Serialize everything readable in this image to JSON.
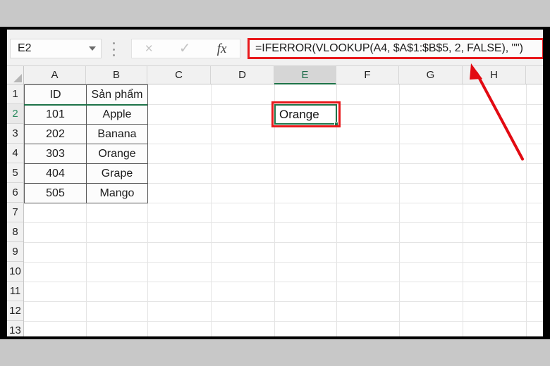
{
  "app": "excel-spreadsheet",
  "formula_bar": {
    "name_box_value": "E2",
    "name_box_caret": "chevron-down-icon",
    "cancel_icon": "×",
    "confirm_icon": "✓",
    "fx_icon": "fx",
    "formula": "=IFERROR(VLOOKUP(A4, $A$1:$B$5, 2, FALSE), \"\")",
    "highlight_color": "#e8181b"
  },
  "grid": {
    "columns": [
      "A",
      "B",
      "C",
      "D",
      "E",
      "F",
      "G",
      "H"
    ],
    "selected_column": "E",
    "rows": [
      "1",
      "2",
      "3",
      "4",
      "5",
      "6",
      "7",
      "8",
      "9",
      "10",
      "11",
      "12",
      "13"
    ],
    "selected_row": "2",
    "selection_color": "#1d7348"
  },
  "table": {
    "headers": [
      "ID",
      "Sản phẩm"
    ],
    "rows": [
      [
        "101",
        "Apple"
      ],
      [
        "202",
        "Banana"
      ],
      [
        "303",
        "Orange"
      ],
      [
        "404",
        "Grape"
      ],
      [
        "505",
        "Mango"
      ]
    ]
  },
  "active_cell": {
    "reference": "E2",
    "value": "Orange"
  },
  "annotation": {
    "arrow_color": "#e20a12",
    "arrow_label": "red-arrow-pointing-to-formula-bar"
  }
}
